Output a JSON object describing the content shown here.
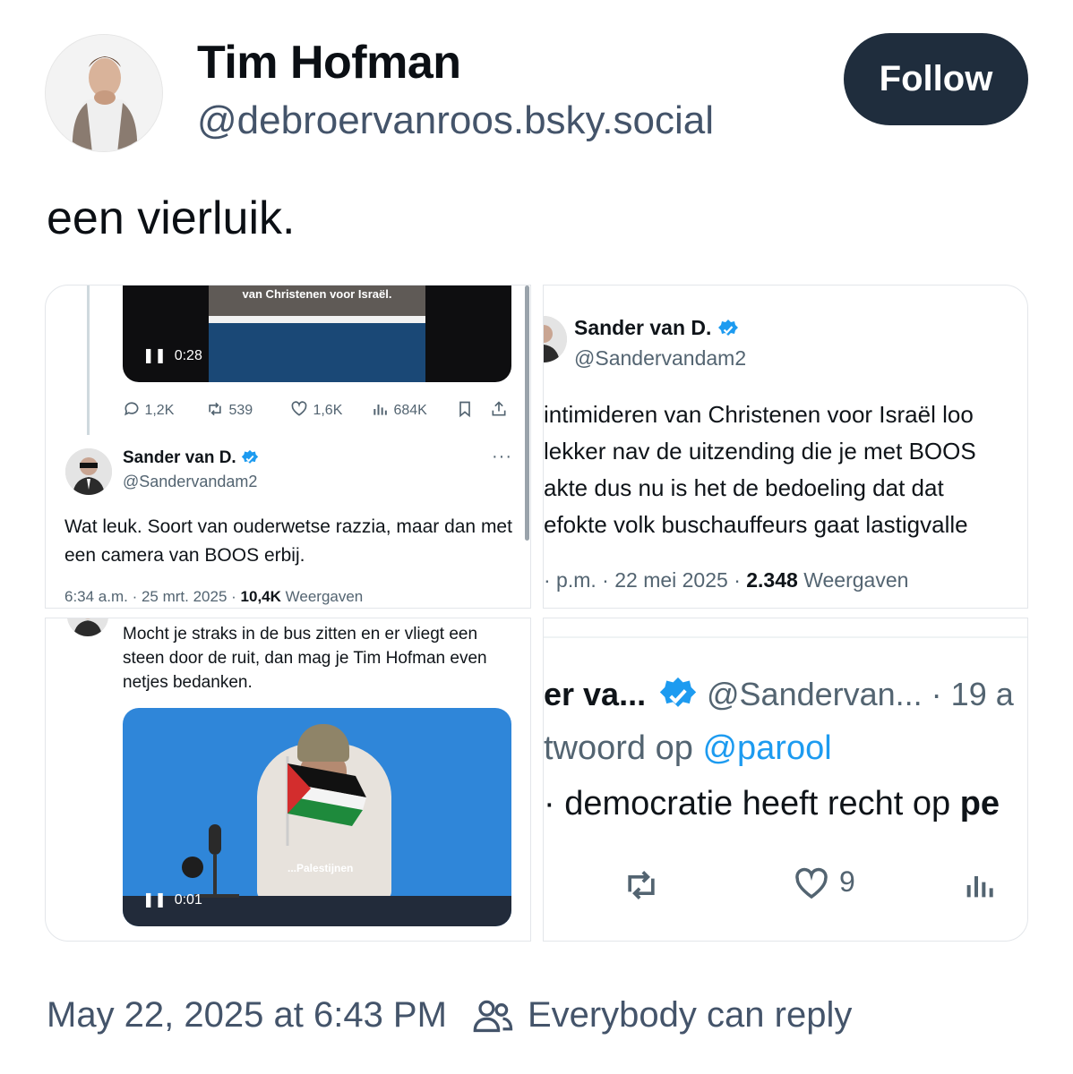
{
  "author": {
    "name": "Tim Hofman",
    "handle": "@debroervanroos.bsky.social",
    "follow_label": "Follow"
  },
  "post": {
    "text": "een vierluik.",
    "timestamp": "May 22, 2025 at 6:43 PM",
    "reply_setting": "Everybody can reply"
  },
  "panels": {
    "p1": {
      "video_subtitle": "van Christenen voor Israël.",
      "video_time": "0:28",
      "actions": {
        "replies": "1,2K",
        "reposts": "539",
        "likes": "1,6K",
        "views": "684K"
      },
      "tweet": {
        "name": "Sander van D.",
        "handle": "@Sandervandam2",
        "text": "Wat leuk. Soort van ouderwetse razzia, maar dan met een camera van BOOS erbij.",
        "time": "6:34 a.m. · 25 mrt. 2025 · ",
        "views_count": "10,4K",
        "views_label": " Weergaven"
      }
    },
    "p2": {
      "name": "Sander van D.",
      "handle": "@Sandervandam2",
      "lines": [
        " intimideren van Christenen voor Israël loo",
        " lekker nav de uitzending die je met BOOS",
        "akte dus nu is het de bedoeling dat dat",
        "efokte volk buschauffeurs gaat lastigvalle"
      ],
      "meta_prefix": "· p.m. · 22 mei 2025 · ",
      "views_count": "2.348",
      "views_label": " Weergaven"
    },
    "p3": {
      "text": "Mocht je straks in de bus zitten en er vliegt een steen door de ruit, dan mag je Tim Hofman even netjes bedanken.",
      "video_subtitle": "...Palestijnen",
      "video_time": "0:01"
    },
    "p4": {
      "name": "er va...",
      "handle": "@Sandervan... · 19 a",
      "reply_prefix": "twoord op ",
      "reply_mention": "@parool",
      "body_normal": "· democratie heeft recht op ",
      "body_bold": "pe",
      "like_count": "9"
    }
  },
  "colors": {
    "follow_bg": "#1f2d3d",
    "verified": "#1d9bf0",
    "link": "#1d9bf0",
    "muted": "#536471"
  },
  "icons": [
    "reply-icon",
    "repost-icon",
    "like-icon",
    "views-icon",
    "bookmark-icon",
    "share-icon",
    "verified-icon",
    "people-icon",
    "pause-icon"
  ]
}
